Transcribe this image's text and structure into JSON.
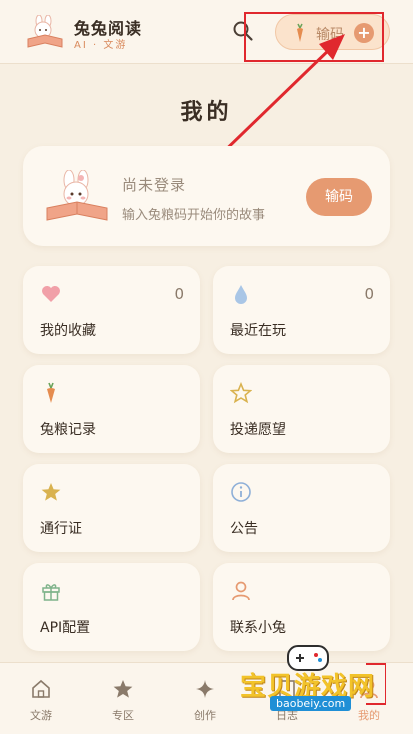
{
  "header": {
    "app_name": "兔兔阅读",
    "app_subtitle": "AI · 文游",
    "code_label": "输码",
    "plus": "+"
  },
  "page_title": "我的",
  "profile": {
    "status": "尚未登录",
    "hint": "输入兔粮码开始你的故事",
    "button_label": "输码"
  },
  "tiles": [
    {
      "label": "我的收藏",
      "count": "0",
      "icon": "heart-icon"
    },
    {
      "label": "最近在玩",
      "count": "0",
      "icon": "drop-icon"
    },
    {
      "label": "兔粮记录",
      "icon": "carrot-icon"
    },
    {
      "label": "投递愿望",
      "icon": "star-outline-icon"
    },
    {
      "label": "通行证",
      "icon": "star-icon"
    },
    {
      "label": "公告",
      "icon": "info-icon"
    },
    {
      "label": "API配置",
      "icon": "gift-icon"
    },
    {
      "label": "联系小兔",
      "icon": "person-icon"
    }
  ],
  "nav": [
    {
      "label": "文游",
      "icon": "home-icon"
    },
    {
      "label": "专区",
      "icon": "star-icon"
    },
    {
      "label": "创作",
      "icon": "sparkle-icon"
    },
    {
      "label": "日志",
      "icon": "book-icon"
    },
    {
      "label": "我的",
      "icon": "person-icon"
    }
  ],
  "watermark": {
    "text": "宝贝游戏网",
    "url": "baobeiy.com"
  },
  "colors": {
    "accent": "#e69a71",
    "background": "#f7efe2",
    "card": "#fdf8f0",
    "highlight": "#e0282e"
  }
}
